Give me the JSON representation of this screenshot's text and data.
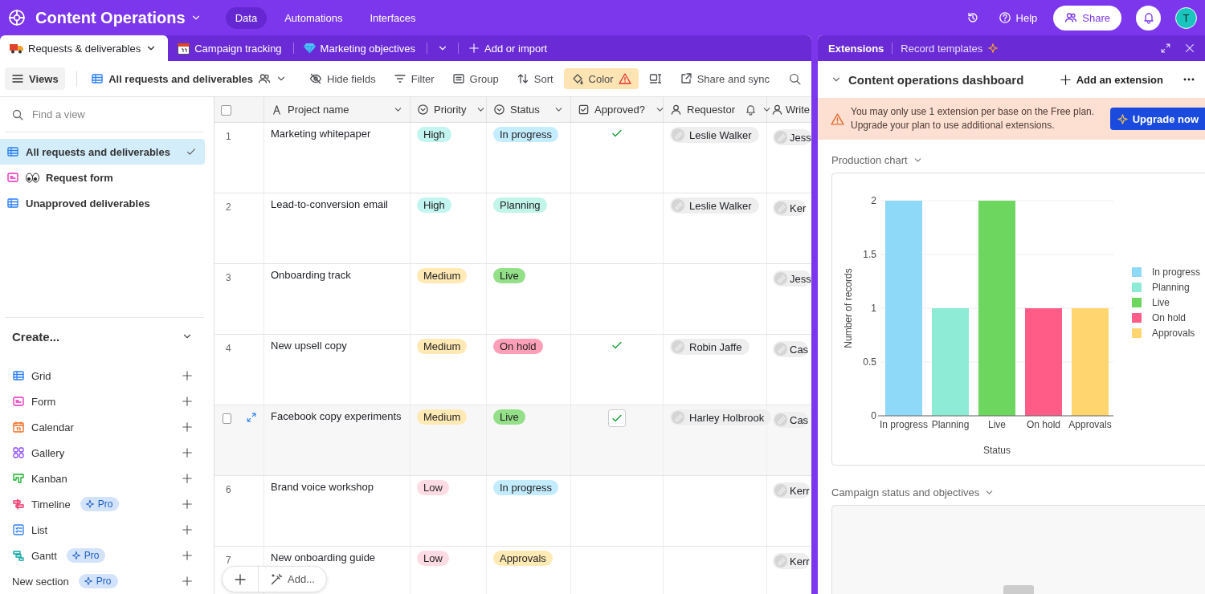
{
  "app": {
    "title": "Content Operations",
    "nav": [
      {
        "label": "Data",
        "selected": true
      },
      {
        "label": "Automations",
        "selected": false
      },
      {
        "label": "Interfaces",
        "selected": false
      }
    ],
    "help": "Help",
    "share": "Share",
    "avatar": "T"
  },
  "table_tabs": [
    {
      "label": "Requests & deliverables",
      "selected": true
    },
    {
      "label": "Campaign tracking",
      "selected": false
    },
    {
      "label": "Marketing objectives",
      "selected": false
    }
  ],
  "add_table": "Add or import",
  "toolbar": {
    "views": "Views",
    "current_view": "All requests and deliverables",
    "buttons": [
      {
        "label": "Hide fields",
        "kind": "hide",
        "active": false
      },
      {
        "label": "Filter",
        "kind": "filter",
        "active": false
      },
      {
        "label": "Group",
        "kind": "group",
        "active": false
      },
      {
        "label": "Sort",
        "kind": "sort",
        "active": false
      },
      {
        "label": "Color",
        "kind": "color",
        "active": true
      },
      {
        "kind": "height",
        "active": false
      },
      {
        "label": "Share and sync",
        "kind": "share",
        "active": false
      }
    ]
  },
  "sidebar": {
    "search": {
      "placeholder": "Find a view"
    },
    "views": [
      {
        "label": "All requests and deliverables",
        "kind": "grid",
        "selected": true
      },
      {
        "label": "Request form",
        "kind": "form",
        "selected": false
      },
      {
        "label": "Unapproved deliverables",
        "kind": "grid",
        "selected": false
      }
    ],
    "create_title": "Create...",
    "create_items": [
      {
        "label": "Grid",
        "kind": "grid"
      },
      {
        "label": "Form",
        "kind": "form"
      },
      {
        "label": "Calendar",
        "kind": "calendar"
      },
      {
        "label": "Gallery",
        "kind": "gallery"
      },
      {
        "label": "Kanban",
        "kind": "kanban"
      },
      {
        "label": "Timeline",
        "kind": "timeline",
        "badge": "Pro"
      },
      {
        "label": "List",
        "kind": "list"
      },
      {
        "label": "Gantt",
        "kind": "gantt",
        "badge": "Pro"
      },
      {
        "label": "New section",
        "kind": "section",
        "badge": "Pro"
      }
    ]
  },
  "grid": {
    "select_all_checked": false,
    "columns": [
      {
        "label": "Project name",
        "kind": "text"
      },
      {
        "label": "Priority",
        "kind": "select"
      },
      {
        "label": "Status",
        "kind": "select"
      },
      {
        "label": "Approved?",
        "kind": "checkbox"
      },
      {
        "label": "Requestor",
        "kind": "user",
        "notify": true
      },
      {
        "label": "Write",
        "kind": "user"
      }
    ],
    "rows": [
      {
        "number": "1",
        "hovered": false,
        "name": "Marketing whitepaper",
        "priority": {
          "label": "High",
          "color": "#c2f5f0"
        },
        "status": {
          "label": "In progress",
          "color": "#c4ecff"
        },
        "approved": true,
        "requestor": "Leslie Walker",
        "writer": "Jess"
      },
      {
        "number": "2",
        "hovered": false,
        "name": "Lead-to-conversion email",
        "priority": {
          "label": "High",
          "color": "#c2f5f0"
        },
        "status": {
          "label": "Planning",
          "color": "#c2f5e9"
        },
        "approved": false,
        "requestor": "Leslie Walker",
        "writer": "Ker"
      },
      {
        "number": "3",
        "hovered": false,
        "name": "Onboarding track",
        "priority": {
          "label": "Medium",
          "color": "#ffeab6"
        },
        "status": {
          "label": "Live",
          "color": "#93e088"
        },
        "approved": false,
        "writer": "Jess"
      },
      {
        "number": "4",
        "hovered": false,
        "name": "New upsell copy",
        "priority": {
          "label": "Medium",
          "color": "#ffeab6"
        },
        "status": {
          "label": "On hold",
          "color": "#ffa0b8"
        },
        "approved": true,
        "requestor": "Robin Jaffe",
        "writer": "Cas"
      },
      {
        "hovered": true,
        "checked": false,
        "name": "Facebook copy experiments",
        "priority": {
          "label": "Medium",
          "color": "#ffeab6"
        },
        "status": {
          "label": "Live",
          "color": "#93e088"
        },
        "approved": true,
        "requestor": "Harley Holbrook",
        "writer": "Cas"
      },
      {
        "number": "6",
        "hovered": false,
        "name": "Brand voice workshop",
        "priority": {
          "label": "Low",
          "color": "#ffdce5"
        },
        "status": {
          "label": "In progress",
          "color": "#c4ecff"
        },
        "approved": false,
        "writer": "Kerr"
      },
      {
        "number": "7",
        "hovered": false,
        "name": "New onboarding guide",
        "priority": {
          "label": "Low",
          "color": "#ffdce5"
        },
        "status": {
          "label": "Approvals",
          "color": "#ffeab6"
        },
        "approved": false,
        "writer": "Kerr"
      }
    ],
    "add_label": "Add..."
  },
  "extensions": {
    "tabs": [
      {
        "label": "Extensions",
        "selected": true
      },
      {
        "label": "Record templates",
        "selected": false
      }
    ],
    "dashboard_title": "Content operations dashboard",
    "add_extension": "Add an extension",
    "banner": {
      "text": "You may only use 1 extension per base on the Free plan. Upgrade your plan to use additional extensions.",
      "button": "Upgrade now"
    },
    "sections": [
      {
        "title": "Production chart",
        "chart_data": {
          "type": "bar",
          "xlabel": "Status",
          "ylabel": "Number of records",
          "categories": [
            "In progress",
            "Planning",
            "Live",
            "On hold",
            "Approvals"
          ],
          "stacked": true,
          "grid": true,
          "legend": true,
          "ylim": [
            0,
            2
          ],
          "yticks": [
            {
              "value": 0,
              "label": "0"
            },
            {
              "value": 0.5,
              "label": "0.5"
            },
            {
              "value": 1,
              "label": "1"
            },
            {
              "value": 1.5,
              "label": "1.5"
            },
            {
              "value": 2,
              "label": "2"
            }
          ],
          "series": [
            {
              "name": "In progress",
              "color": "#8ed8f8",
              "values": [
                2,
                null,
                null,
                null,
                null
              ]
            },
            {
              "name": "Planning",
              "color": "#8eebd6",
              "values": [
                null,
                1,
                null,
                null,
                null
              ]
            },
            {
              "name": "Live",
              "color": "#6dd65e",
              "values": [
                null,
                null,
                2,
                null,
                null
              ]
            },
            {
              "name": "On hold",
              "color": "#ff5c87",
              "values": [
                null,
                null,
                null,
                1,
                null
              ]
            },
            {
              "name": "Approvals",
              "color": "#ffd570",
              "values": [
                null,
                null,
                null,
                null,
                1
              ]
            }
          ]
        }
      },
      {
        "title": "Campaign status and objectives"
      }
    ]
  }
}
